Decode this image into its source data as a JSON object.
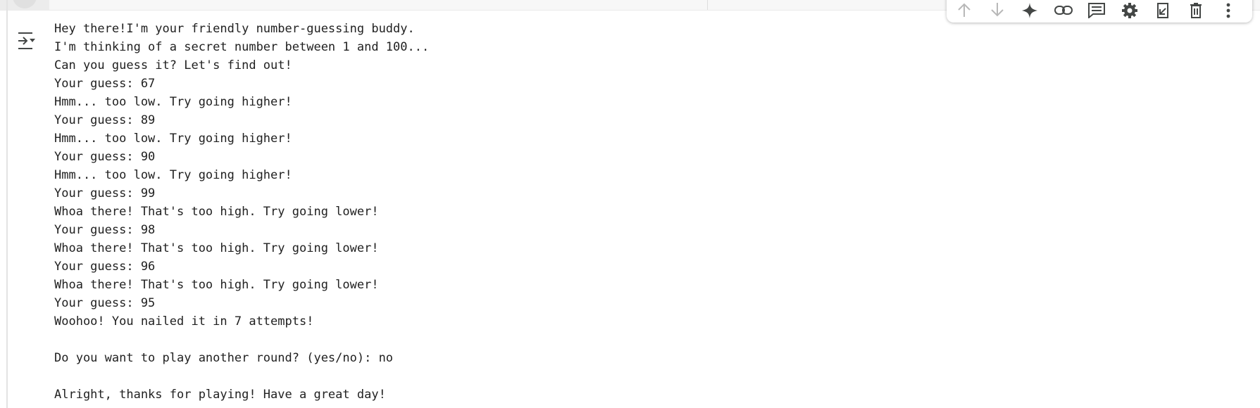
{
  "output": {
    "lines": [
      "Hey there!I'm your friendly number-guessing buddy.",
      "I'm thinking of a secret number between 1 and 100...",
      "Can you guess it? Let's find out!",
      "Your guess: 67",
      "Hmm... too low. Try going higher!",
      "Your guess: 89",
      "Hmm... too low. Try going higher!",
      "Your guess: 90",
      "Hmm... too low. Try going higher!",
      "Your guess: 99",
      "Whoa there! That's too high. Try going lower!",
      "Your guess: 98",
      "Whoa there! That's too high. Try going lower!",
      "Your guess: 96",
      "Whoa there! That's too high. Try going lower!",
      "Your guess: 95",
      "Woohoo! You nailed it in 7 attempts!",
      "",
      "Do you want to play another round? (yes/no): no",
      "",
      "Alright, thanks for playing! Have a great day!"
    ]
  },
  "toolbar": {
    "icons": [
      "move-up-icon",
      "move-down-icon",
      "gemini-sparkle-icon",
      "link-icon",
      "comment-icon",
      "settings-gear-icon",
      "mirror-in-tab-icon",
      "delete-icon",
      "more-vert-icon"
    ]
  },
  "output_toggle_icon": "output-actions-icon",
  "colors": {
    "text": "#212121",
    "icon": "#444746",
    "icon_disabled": "#b8b8b8"
  }
}
